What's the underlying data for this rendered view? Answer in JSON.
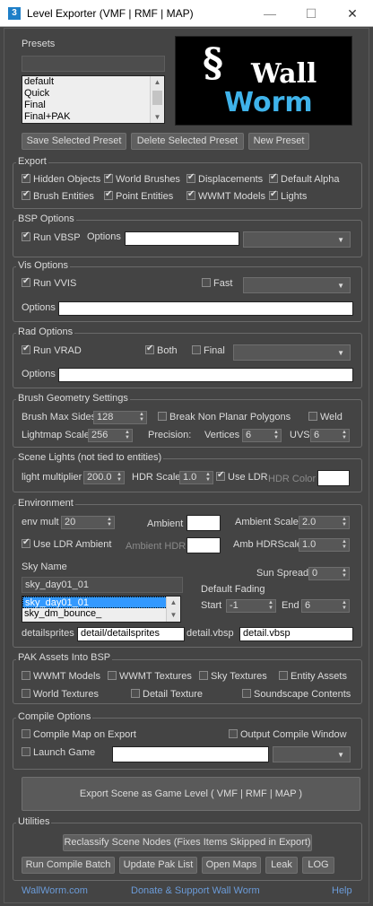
{
  "window": {
    "title": "Level Exporter (VMF | RMF | MAP)",
    "app_icon": "3",
    "min": "—",
    "max": "☐",
    "close": "✕"
  },
  "presets": {
    "label": "Presets",
    "items": [
      "default",
      "Quick",
      "Final",
      "Final+PAK"
    ],
    "save": "Save Selected Preset",
    "delete": "Delete Selected Preset",
    "new": "New Preset",
    "logo_wall": "Wall",
    "logo_worm": "Worm"
  },
  "export": {
    "label": "Export",
    "hidden": "Hidden Objects",
    "brushes": "World Brushes",
    "disp": "Displacements",
    "alpha": "Default Alpha",
    "brush_ent": "Brush Entities",
    "point_ent": "Point Entities",
    "wwmt": "WWMT Models",
    "lights": "Lights"
  },
  "bsp": {
    "label": "BSP Options",
    "run": "Run VBSP",
    "options": "Options"
  },
  "vis": {
    "label": "Vis Options",
    "run": "Run VVIS",
    "fast": "Fast",
    "options": "Options"
  },
  "rad": {
    "label": "Rad Options",
    "run": "Run VRAD",
    "both": "Both",
    "final": "Final",
    "options": "Options"
  },
  "brushgeo": {
    "label": "Brush Geometry Settings",
    "max_sides": "Brush Max Sides",
    "max_sides_val": "128",
    "break": "Break Non Planar Polygons",
    "weld": "Weld",
    "lm_scale": "Lightmap Scale",
    "lm_val": "256",
    "precision": "Precision:",
    "vertices": "Vertices",
    "vert_val": "6",
    "uvs": "UVS",
    "uvs_val": "6"
  },
  "scenelights": {
    "label": "Scene Lights (not tied to entities)",
    "mult": "light multiplier",
    "mult_val": "200.0",
    "hdr": "HDR Scale",
    "hdr_val": "1.0",
    "ldr": "Use LDR",
    "hdr_color": "HDR Color"
  },
  "env": {
    "label": "Environment",
    "env_mult": "env mult",
    "env_mult_val": "20",
    "ambient": "Ambient",
    "amb_scale": "Ambient Scale",
    "amb_scale_val": "2.0",
    "ldr_amb": "Use LDR Ambient",
    "amb_hdr": "Ambient HDR",
    "amb_hdr_scale": "Amb HDRScale",
    "amb_hdr_scale_val": "1.0",
    "sky_name": "Sky Name",
    "sky_val": "sky_day01_01",
    "sky_items": [
      "sky_day01_01",
      "sky_dm_bounce_"
    ],
    "sun_spread": "Sun Spread",
    "sun_val": "0",
    "fading": "Default Fading",
    "start": "Start",
    "start_val": "-1",
    "end": "End",
    "end_val": "6",
    "detailsprites": "detailsprites",
    "ds_val": "detail/detailsprites",
    "detail_vbsp": "detail.vbsp",
    "dv_val": "detail.vbsp"
  },
  "pak": {
    "label": "PAK Assets Into BSP",
    "wwmt": "WWMT Models",
    "wwmt_tex": "WWMT Textures",
    "sky_tex": "Sky Textures",
    "entity": "Entity Assets",
    "world_tex": "World Textures",
    "detail_tex": "Detail Texture",
    "soundscape": "Soundscape Contents"
  },
  "compile": {
    "label": "Compile Options",
    "compile_map": "Compile Map on Export",
    "output": "Output Compile Window",
    "launch": "Launch Game"
  },
  "export_btn": "Export Scene as Game Level ( VMF | RMF | MAP )",
  "utilities": {
    "label": "Utilities",
    "reclassify": "Reclassify Scene Nodes (Fixes Items Skipped in Export)",
    "batch": "Run Compile Batch",
    "pak": "Update Pak List",
    "maps": "Open Maps",
    "leak": "Leak",
    "log": "LOG"
  },
  "footer": {
    "site": "WallWorm.com",
    "donate": "Donate & Support Wall Worm",
    "help": "Help"
  }
}
